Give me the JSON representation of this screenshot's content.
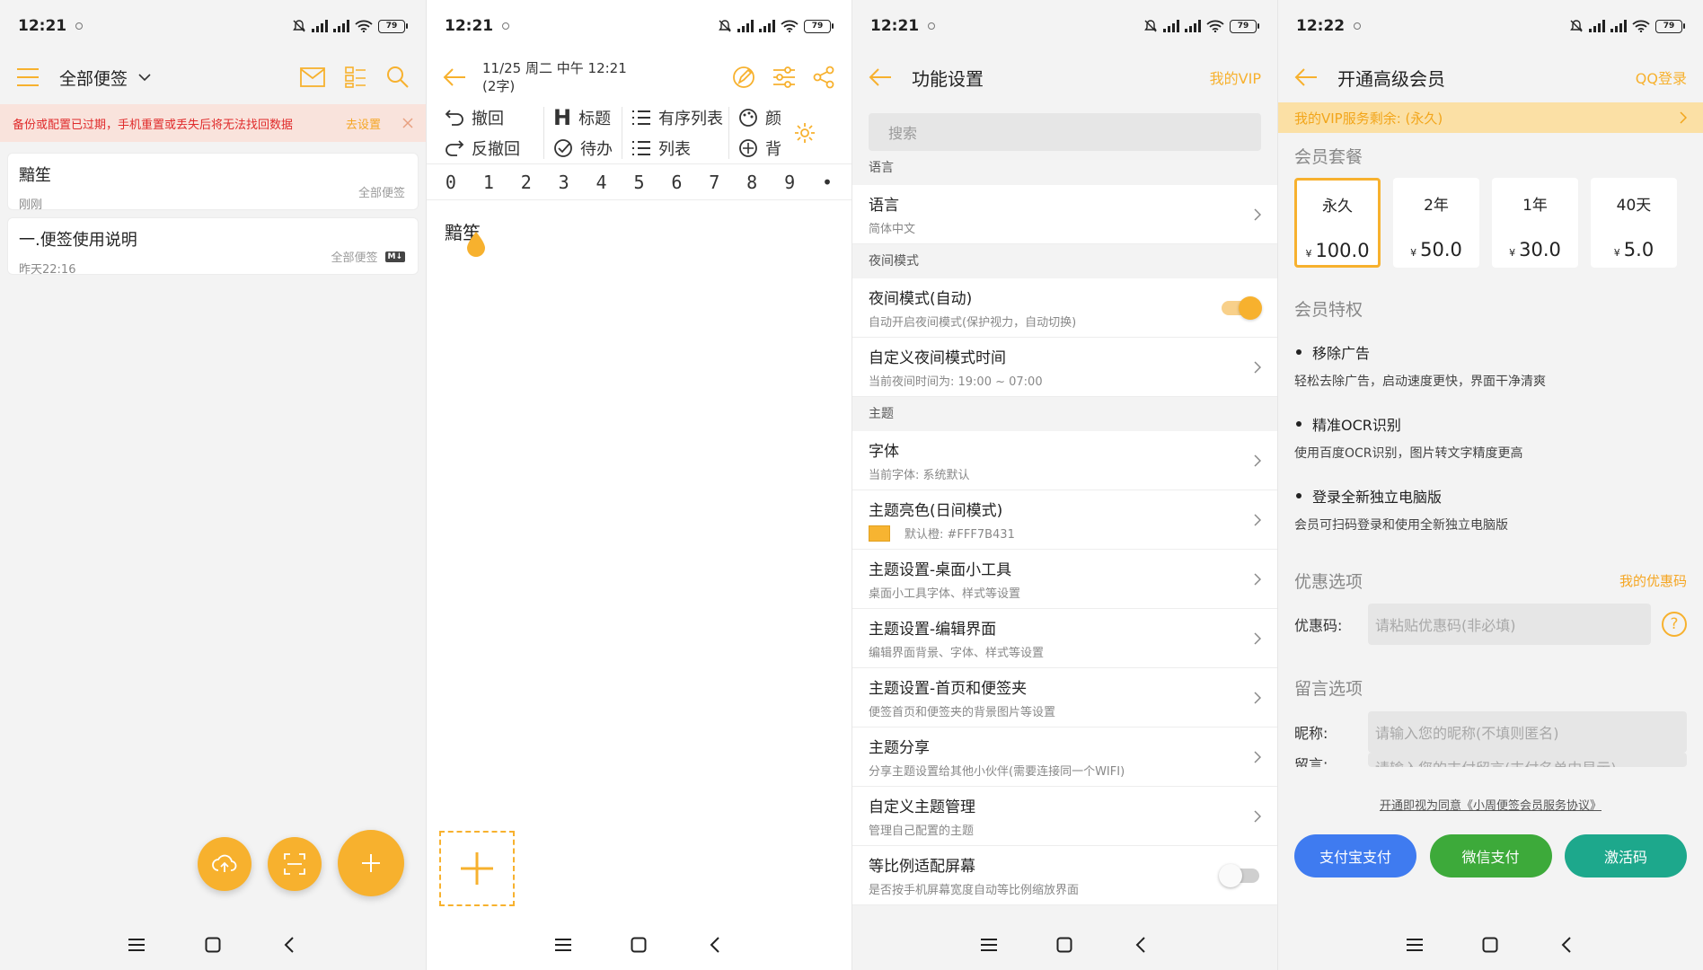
{
  "colors": {
    "accent": "#F7B12E",
    "alipay": "#3F7BF0",
    "wechat": "#3DAA3A",
    "activation": "#1DA88C",
    "warning_text": "#E02B2B"
  },
  "panels": [
    {
      "status": {
        "time": "12:21",
        "battery": "79"
      },
      "header": {
        "title": "全部便签"
      },
      "warning": {
        "text": "备份或配置已过期，手机重置或丢失后将无法找回数据",
        "action": "去设置"
      },
      "notes": [
        {
          "title": "黯笙",
          "time": "刚刚",
          "folder": "全部便签"
        },
        {
          "title": "一.便签使用说明",
          "time": "昨天22:16",
          "folder": "全部便签",
          "badge": "M↓"
        }
      ]
    },
    {
      "status": {
        "time": "12:21",
        "battery": "79"
      },
      "header": {
        "date": "11/25 周二 中午 12:21",
        "count": "(2字)"
      },
      "toolbar": {
        "undo": "撤回",
        "redo": "反撤回",
        "heading": "标题",
        "todo": "待办",
        "ordered_list": "有序列表",
        "list": "列表",
        "color": "颜",
        "background": "背",
        "numbers": [
          "0",
          "1",
          "2",
          "3",
          "4",
          "5",
          "6",
          "7",
          "8",
          "9",
          "•"
        ]
      },
      "editor": {
        "text": "黯笙"
      }
    },
    {
      "status": {
        "time": "12:21",
        "battery": "79"
      },
      "header": {
        "title": "功能设置",
        "right": "我的VIP"
      },
      "search": {
        "placeholder": "搜索"
      },
      "sections": {
        "language": "语言",
        "night": "夜间模式",
        "theme": "主题"
      },
      "rows": [
        {
          "title": "语言",
          "sub": "简体中文"
        },
        {
          "title": "夜间模式(自动)",
          "sub": "自动开启夜间模式(保护视力，自动切换)"
        },
        {
          "title": "自定义夜间模式时间",
          "sub": "当前夜间时间为: 19:00 ~ 07:00"
        },
        {
          "title": "字体",
          "sub": "当前字体: 系统默认"
        },
        {
          "title": "主题亮色(日间模式)",
          "sub": "默认橙: #FFF7B431"
        },
        {
          "title": "主题设置-桌面小工具",
          "sub": "桌面小工具字体、样式等设置"
        },
        {
          "title": "主题设置-编辑界面",
          "sub": "编辑界面背景、字体、样式等设置"
        },
        {
          "title": "主题设置-首页和便签夹",
          "sub": "便签首页和便签夹的背景图片等设置"
        },
        {
          "title": "主题分享",
          "sub": "分享主题设置给其他小伙伴(需要连接同一个WIFI)"
        },
        {
          "title": "自定义主题管理",
          "sub": "管理自己配置的主题"
        },
        {
          "title": "等比例适配屏幕",
          "sub": "是否按手机屏幕宽度自动等比例缩放界面"
        }
      ]
    },
    {
      "status": {
        "time": "12:22",
        "battery": "79"
      },
      "header": {
        "title": "开通高级会员",
        "right": "QQ登录"
      },
      "vip_bar": "我的VIP服务剩余: (永久)",
      "plans_title": "会员套餐",
      "plans": [
        {
          "name": "永久",
          "currency": "¥",
          "price": "100.0"
        },
        {
          "name": "2年",
          "currency": "¥",
          "price": "50.0"
        },
        {
          "name": "1年",
          "currency": "¥",
          "price": "30.0"
        },
        {
          "name": "40天",
          "currency": "¥",
          "price": "5.0"
        }
      ],
      "perks_title": "会员特权",
      "perks": [
        {
          "title": "移除广告",
          "desc": "轻松去除广告，启动速度更快，界面干净清爽"
        },
        {
          "title": "精准OCR识别",
          "desc": "使用百度OCR识别，图片转文字精度更高"
        },
        {
          "title": "登录全新独立电脑版",
          "desc": "会员可扫码登录和使用全新独立电脑版"
        }
      ],
      "coupon": {
        "title": "优惠选项",
        "link": "我的优惠码",
        "label": "优惠码:",
        "placeholder": "请粘贴优惠码(非必填)"
      },
      "message": {
        "title": "留言选项",
        "nick_label": "昵称:",
        "nick_placeholder": "请输入您的昵称(不填则匿名)",
        "msg_label": "留言:",
        "msg_placeholder": "请输入您的支付留言(支付名单中显示)"
      },
      "agreement": "开通即视为同意《小周便签会员服务协议》",
      "buttons": {
        "alipay": "支付宝支付",
        "wechat": "微信支付",
        "activation": "激活码"
      }
    }
  ]
}
